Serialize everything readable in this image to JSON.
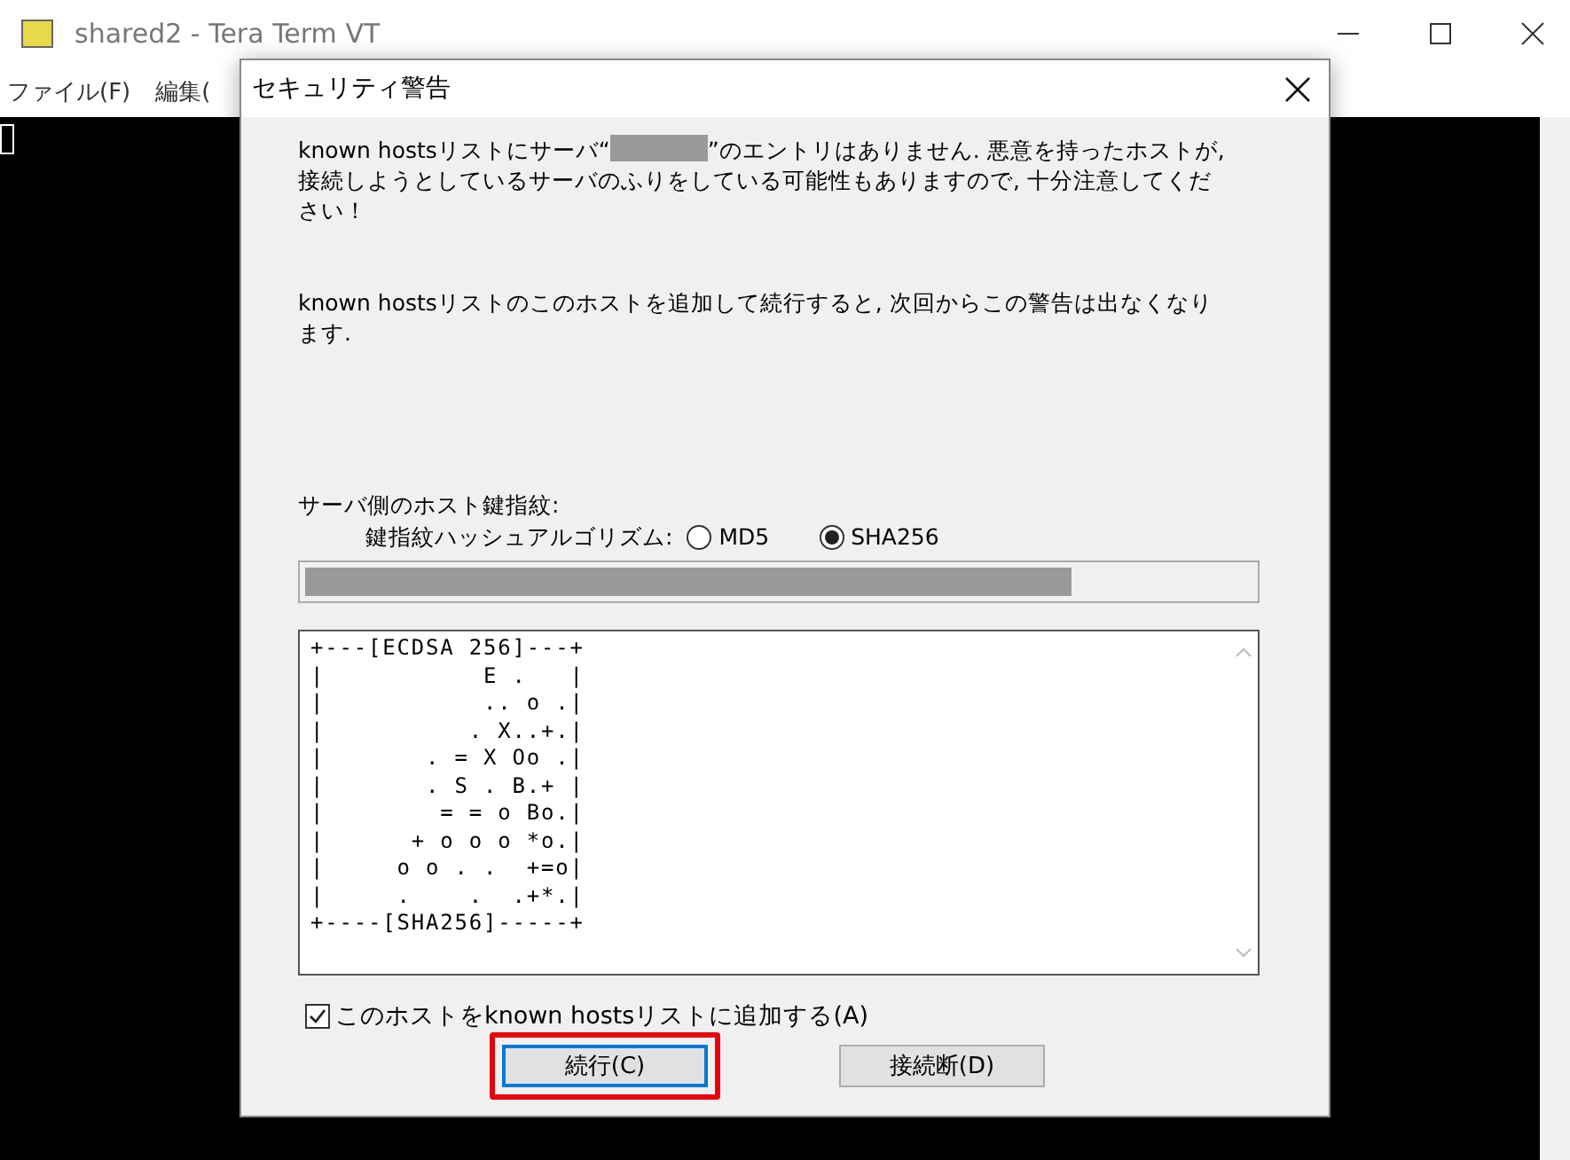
{
  "window": {
    "title": "shared2 - Tera Term VT"
  },
  "menu": [
    "ファイル(F)",
    "編集("
  ],
  "dialog": {
    "title": "セキュリティ警告",
    "message_before": "known hostsリストにサーバ“",
    "message_after": "”のエントリはありません. 悪意を持ったホストが, 接続しようとしているサーバのふりをしている可能性もありますので, 十分注意してください！",
    "note": "known hostsリストのこのホストを追加して続行すると, 次回からこの警告は出なくなります.",
    "fingerprint_label": "サーバ側のホスト鍵指紋:",
    "algorithm_label": "鍵指紋ハッシュアルゴリズム:",
    "algorithms": [
      {
        "label": "MD5",
        "selected": false
      },
      {
        "label": "SHA256",
        "selected": true
      }
    ],
    "randomart": [
      "+---[ECDSA 256]---+",
      "|           E .   |",
      "|           .. o .|",
      "|          . X..+.|",
      "|       . = X Oo .|",
      "|       . S . B.+ |",
      "|        = = o Bo.|",
      "|      + o o o *o.|",
      "|     o o . .  +=o|",
      "|     .    .  .+*.|",
      "+----[SHA256]-----+"
    ],
    "add_checkbox": {
      "label": "このホストをknown hostsリストに追加する(A)",
      "checked": true
    },
    "buttons": [
      {
        "label": "続行(C)",
        "focused": true,
        "highlighted": true
      },
      {
        "label": "接続断(D)",
        "focused": false,
        "highlighted": false
      }
    ]
  }
}
